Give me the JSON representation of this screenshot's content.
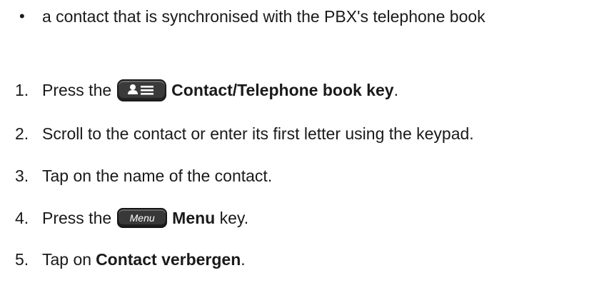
{
  "bullet": {
    "mark": "•",
    "text": "a contact that is synchronised with the PBX's telephone book"
  },
  "steps": [
    {
      "num": "1.",
      "pre": "Press the",
      "bold": "Contact/Telephone book key",
      "post": "."
    },
    {
      "num": "2.",
      "text": "Scroll to the contact or enter its first letter using the keypad."
    },
    {
      "num": "3.",
      "text": "Tap on the name of the contact."
    },
    {
      "num": "4.",
      "pre": "Press the",
      "key_label": "Menu",
      "bold": "Menu",
      "post": " key."
    },
    {
      "num": "5.",
      "pre": "Tap on",
      "bold": "Contact verbergen",
      "post": "."
    }
  ],
  "icons": {
    "contact_key": "contact-telephone-book-key-icon",
    "menu_key": "menu-key-icon"
  }
}
